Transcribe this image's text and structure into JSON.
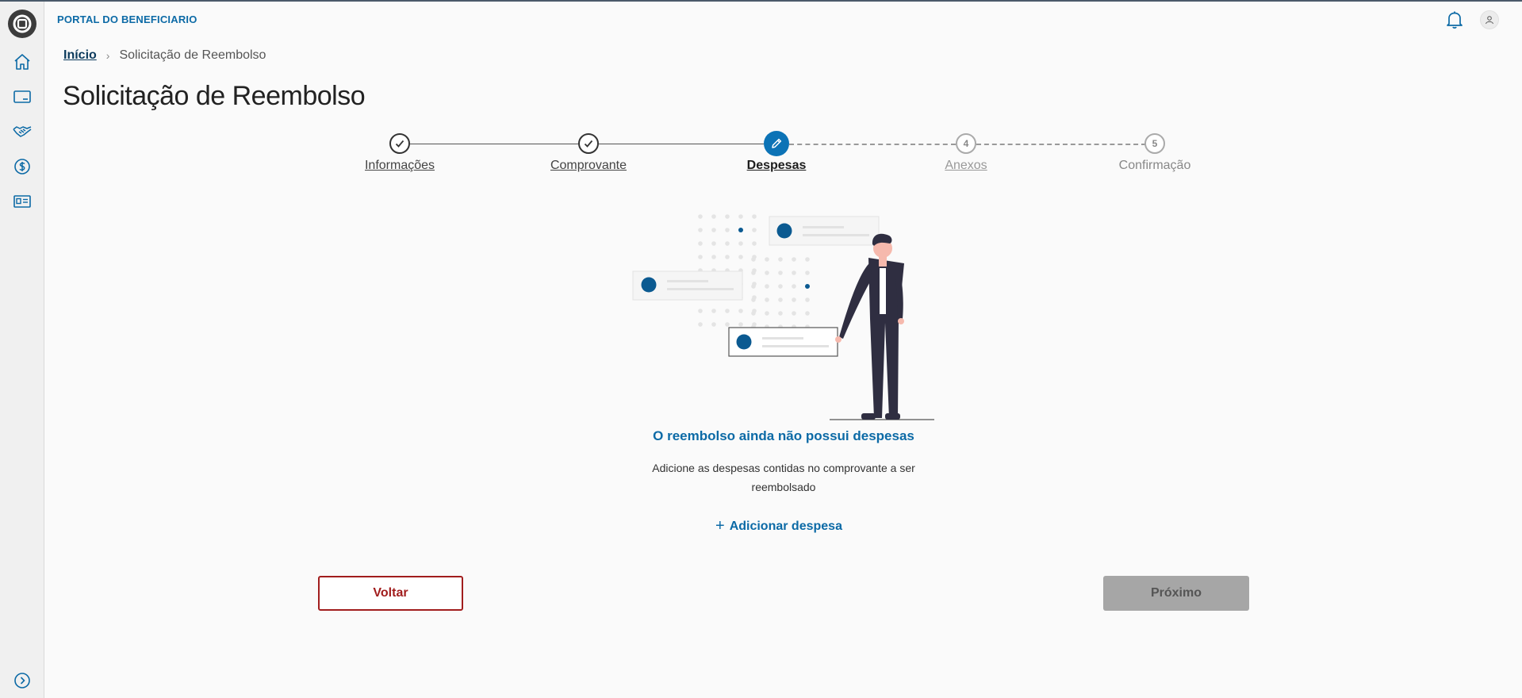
{
  "header": {
    "app_title": "PORTAL DO BENEFICIARIO"
  },
  "sidebar": {
    "items": [
      {
        "icon": "home-icon"
      },
      {
        "icon": "card-icon"
      },
      {
        "icon": "handshake-icon"
      },
      {
        "icon": "dollar-icon"
      },
      {
        "icon": "id-card-icon"
      }
    ],
    "expand_icon": "chevron-right-circle-icon"
  },
  "breadcrumb": {
    "home": "Início",
    "current": "Solicitação de Reembolso"
  },
  "page": {
    "title": "Solicitação de Reembolso"
  },
  "stepper": {
    "steps": [
      {
        "label": "Informações",
        "state": "done"
      },
      {
        "label": "Comprovante",
        "state": "done"
      },
      {
        "label": "Despesas",
        "state": "active"
      },
      {
        "label": "Anexos",
        "number": "4",
        "state": "pending"
      },
      {
        "label": "Confirmação",
        "number": "5",
        "state": "pending"
      }
    ]
  },
  "empty_state": {
    "title": "O reembolso ainda não possui despesas",
    "description": "Adicione as despesas contidas no comprovante a ser reembolsado",
    "add_label": "Adicionar despesa"
  },
  "actions": {
    "back_label": "Voltar",
    "next_label": "Próximo"
  },
  "colors": {
    "accent": "#0c73b6",
    "danger": "#a11d1d",
    "disabled": "#a6a6a6"
  }
}
